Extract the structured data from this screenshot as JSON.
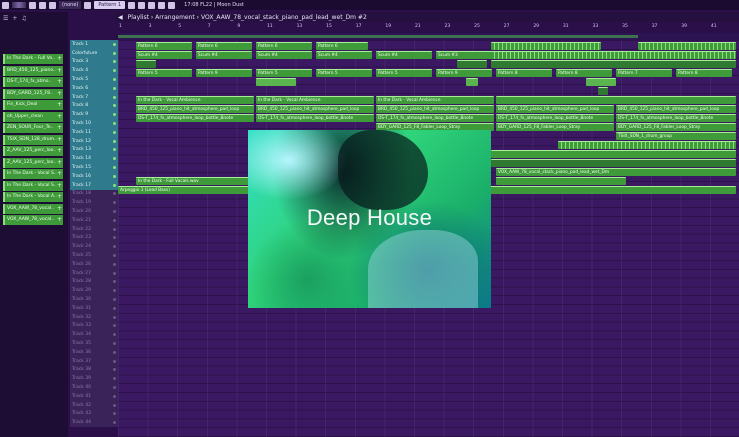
{
  "toolbar": {
    "pattern_label": "Pattern 1",
    "none_label": "(none)",
    "sys_info": "17:08  FL22 | Moon Dust"
  },
  "playlist": {
    "title": "Playlist › Arrangement › VOX_AAW_78_vocal_stack_piano_pad_lead_wet_Dm #2"
  },
  "picker": {
    "items": [
      "In The Dark - Full Vo..",
      "BRD_450_125_piano..",
      "DS-T_174_fx_atmo..",
      "BDY_GARD_125_F8..",
      "Fin_Kick_Deal",
      "oh_Upper_clean",
      "ZEN_SOUR_Four_Te..",
      "TSIX_SDN_128_drum..",
      "Z_AAV_125_perc_loo..",
      "Z_AAV_125_perc_loo..",
      "In The Dark - Vocal S..",
      "In The Dark - Vocal S..",
      "In The Dark - Vocal A..",
      "VOX_AAW_78_vocal..",
      "VOX_AAW_78_vocal.."
    ]
  },
  "tracks": [
    "Track 1",
    "Colorfuture",
    "Track 3",
    "Track 4",
    "Track 5",
    "Track 6",
    "Track 7",
    "Track 8",
    "Track 9",
    "Track 10",
    "Track 11",
    "Track 12",
    "Track 13",
    "Track 14",
    "Track 15",
    "Track 16",
    "Track 17",
    "Track 18",
    "Track 19",
    "Track 20",
    "Track 21",
    "Track 22",
    "Track 23",
    "Track 24",
    "Track 25",
    "Track 26",
    "Track 27",
    "Track 28",
    "Track 29",
    "Track 30",
    "Track 31",
    "Track 32",
    "Track 33",
    "Track 34",
    "Track 35",
    "Track 36",
    "Track 37",
    "Track 38",
    "Track 39",
    "Track 40",
    "Track 41",
    "Track 42",
    "Track 43",
    "Track 44"
  ],
  "bars": [
    "1",
    "3",
    "5",
    "7",
    "9",
    "11",
    "13",
    "15",
    "17",
    "19",
    "21",
    "23",
    "25",
    "27",
    "29",
    "31",
    "33",
    "35",
    "37",
    "39",
    "41"
  ],
  "clips": {
    "pattern6": "Pattern 6",
    "scum4": "Scum #4",
    "scum3": "Scum #3",
    "pattern9": "Pattern 9",
    "pattern5": "Pattern 5",
    "pattern8": "Pattern 8",
    "pattern7": "Pattern 7",
    "vocal_amb": "In the Dark - Vocal Ambience",
    "vocal_amb2": "In the Dark - Vocal Ambience",
    "brd_clip": "BRD_450_125_piano_hit_atmosphere_pad_loop",
    "dst_clip": "DS-T_174_fx_atmosphere_loop_bottle_Bnote",
    "bdy_clip": "BDY_GARD_125_F8_Fabler_Loop_Stray",
    "tsix_clip": "TSIX_SDN_1_drum_group",
    "vox_clip": "VOX_AAW_78_vocal_stack_piano_pad_lead_wet_Dm",
    "vocal_full": "In the Dark - Full Vocals.wav",
    "arpeggio": "Arpeggio 1 (Lead Bass)"
  },
  "album": {
    "title": "Deep House"
  }
}
